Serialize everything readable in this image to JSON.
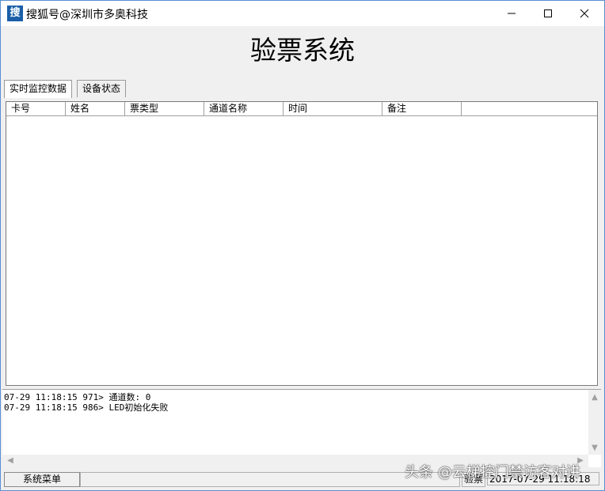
{
  "titlebar": {
    "icon_text": "搜",
    "title": "搜狐号@深圳市多奥科技"
  },
  "header": {
    "title": "验票系统"
  },
  "tabs": [
    {
      "label": "实时监控数据",
      "active": true
    },
    {
      "label": "设备状态",
      "active": false
    }
  ],
  "grid": {
    "columns": [
      "卡号",
      "姓名",
      "票类型",
      "通道名称",
      "时间",
      "备注"
    ],
    "rows": []
  },
  "log": {
    "lines": [
      "07-29 11:18:15 971> 通道数: 0",
      "07-29 11:18:15 986> LED初始化失败"
    ]
  },
  "statusbar": {
    "menu_button": "系统菜单",
    "mode": "验票",
    "datetime": "2017-07-29 11:18:18"
  },
  "watermark": "头条 @云梯控门禁访客对讲"
}
